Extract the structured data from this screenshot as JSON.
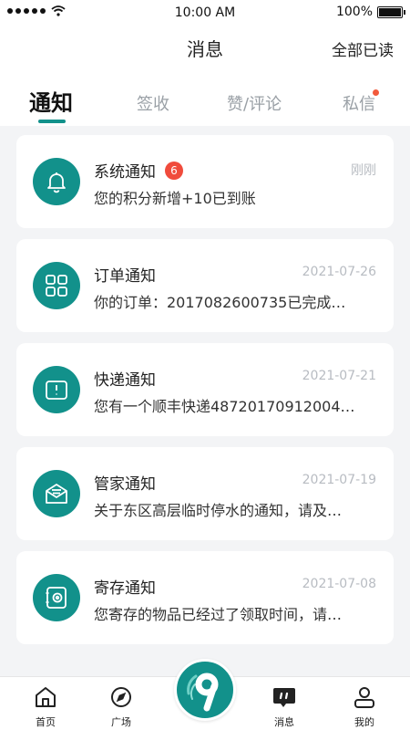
{
  "status_bar": {
    "time": "10:00 AM",
    "battery": "100%"
  },
  "header": {
    "title": "消息",
    "mark_all_read": "全部已读"
  },
  "tabs": [
    {
      "label": "通知",
      "active": true
    },
    {
      "label": "签收",
      "active": false
    },
    {
      "label": "赞/评论",
      "active": false
    },
    {
      "label": "私信",
      "active": false,
      "has_dot": true
    }
  ],
  "notifications": [
    {
      "title": "系统通知",
      "badge": "6",
      "time": "刚刚",
      "message": "您的积分新增+10已到账",
      "icon": "bell-icon"
    },
    {
      "title": "订单通知",
      "time": "2021-07-26",
      "message": "你的订单：2017082600735已完成…",
      "icon": "grid-icon"
    },
    {
      "title": "快递通知",
      "time": "2021-07-21",
      "message": "您有一个顺丰快递48720170912004…",
      "icon": "parcel-icon"
    },
    {
      "title": "管家通知",
      "time": "2021-07-19",
      "message": "关于东区高层临时停水的通知，请及…",
      "icon": "mail-icon"
    },
    {
      "title": "寄存通知",
      "time": "2021-07-08",
      "message": "您寄存的物品已经过了领取时间，请…",
      "icon": "safe-icon"
    }
  ],
  "bottom_nav": {
    "home": "首页",
    "square": "广场",
    "messages": "消息",
    "mine": "我的"
  },
  "colors": {
    "accent": "#12918b",
    "badge": "#f04b3c"
  }
}
